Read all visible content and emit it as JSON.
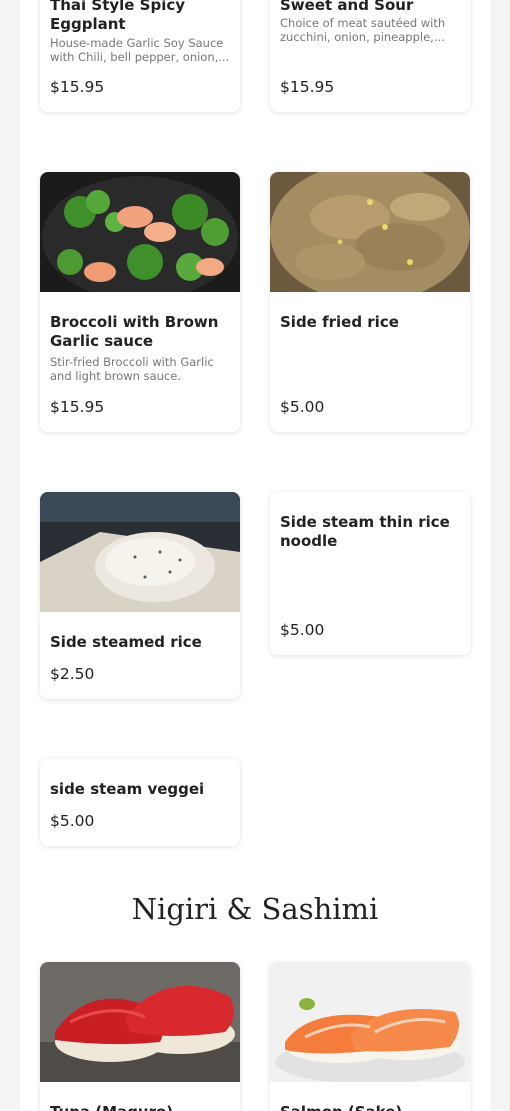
{
  "items": [
    {
      "name": "Thai Style Spicy Eggplant",
      "desc": "House-made Garlic Soy Sauce with Chili, bell pepper, onion,...",
      "price": "$15.95"
    },
    {
      "name": "Sweet and Sour",
      "desc": "Choice of meat sautéed with zucchini, onion, pineapple,...",
      "price": "$15.95"
    },
    {
      "name": "Broccoli with Brown Garlic sauce",
      "desc": "Stir-fried Broccoli with Garlic and light brown sauce.",
      "price": "$15.95"
    },
    {
      "name": "Side fried rice",
      "desc": "",
      "price": "$5.00"
    },
    {
      "name": "Side steamed rice",
      "desc": "",
      "price": "$2.50"
    },
    {
      "name": "Side steam thin rice noodle",
      "desc": "",
      "price": "$5.00"
    },
    {
      "name": "side steam veggei",
      "desc": "",
      "price": "$5.00"
    },
    {
      "name": "Tuna (Maguro)",
      "desc": "",
      "price": ""
    },
    {
      "name": "Salmon (Sake)",
      "desc": "",
      "price": ""
    }
  ],
  "sections": {
    "nigiri_title": "Nigiri & Sashimi"
  },
  "icons": {
    "broccoli_shrimp": "broccoli-shrimp-photo",
    "fried_rice": "fried-rice-photo",
    "steamed_rice": "steamed-rice-photo",
    "tuna": "tuna-nigiri-photo",
    "salmon": "salmon-nigiri-photo"
  }
}
